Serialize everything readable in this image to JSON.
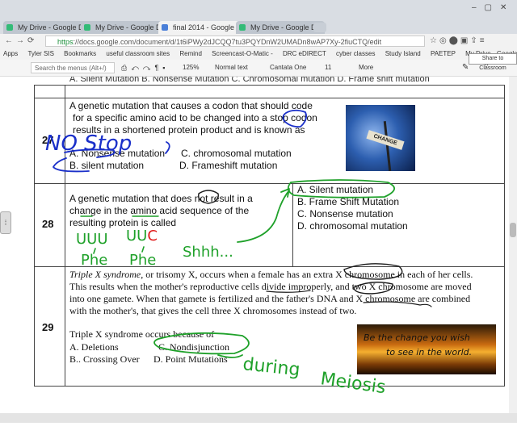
{
  "browser": {
    "tabs": [
      {
        "label": "My Drive - Google Drive",
        "active": false
      },
      {
        "label": "My Drive - Google Drive",
        "active": false
      },
      {
        "label": "final 2014 - Google Docs",
        "active": true
      },
      {
        "label": "My Drive - Google Drive",
        "active": false
      }
    ],
    "url_scheme": "https",
    "url": "://docs.google.com/document/d/1t6iPWy2dJCQQ7tu3PQYDnW2UMADn8wAP7Xy-2fiuCTQ/edit",
    "bookmarks": [
      "Apps",
      "Tyler SIS",
      "Bookmarks",
      "useful classroom sites",
      "Remind",
      "Screencast-O-Matic -",
      "DRC eDIRECT",
      "cyber classes",
      "Study Island",
      "PAETEP",
      "My Drive - Google Dr"
    ],
    "tooltip": "Share to Classroom"
  },
  "toolbar": {
    "search_placeholder": "Search the menus (Alt+/)",
    "zoom": "125%",
    "style": "Normal text",
    "font": "Cantata One",
    "font_size": "11",
    "more": "More"
  },
  "document": {
    "cut_line": "A. Silent Mutation   B. Nonsense Mutation   C. Chromosomal mutation   D. Frame shift mutation",
    "q27": {
      "number": "27",
      "text": [
        "A genetic mutation that causes a codon that should code",
        "for a specific amino acid to be changed into a stop codon",
        "results in a shortened protein product and is known as"
      ],
      "options": [
        "A.  Nonsense mutation",
        "C.  chromosomal mutation",
        "B.  silent mutation",
        "D.  Frameshift mutation"
      ],
      "image_sign": "CHANGE"
    },
    "q28": {
      "number": "28",
      "text": [
        "A genetic mutation that does not result in a",
        "change in the amino acid sequence of the",
        "resulting protein is called"
      ],
      "options": [
        "A.  Silent mutation",
        "B.  Frame Shift Mutation",
        "C.  Nonsense mutation",
        "D.  chromosomal mutation"
      ]
    },
    "q29": {
      "number": "29",
      "paragraph": [
        "Triple X syndrome, or trisomy X, occurs when a female has an extra X chromosome in each of her cells.",
        "This results when the mother's reproductive cells divide improperly, and two X chromosome are moved",
        "into one gamete. When that gamete is fertilized and the father's DNA and X chromosome are combined",
        "with the mother's, that gives the cell three X chromosomes instead of two."
      ],
      "question": "Triple X syndrome occurs because of",
      "options": [
        "A.  Deletions",
        "C.  Nondisjunction",
        "B..  Crossing Over",
        "D.  Point Mutations"
      ],
      "image_text": [
        "Be the change you wish",
        "to see in the world."
      ]
    }
  },
  "annotations": {
    "no_stop": "NO Stop",
    "codons": [
      "UUU",
      "UUC"
    ],
    "phe": [
      "Phe",
      "Phe"
    ],
    "shhh": "Shhh...",
    "during": "during",
    "meiosis": "Meiosis"
  },
  "colors": {
    "ink_blue": "#1a2fc9",
    "ink_green": "#1fa12a",
    "ink_red": "#e01b1b"
  }
}
